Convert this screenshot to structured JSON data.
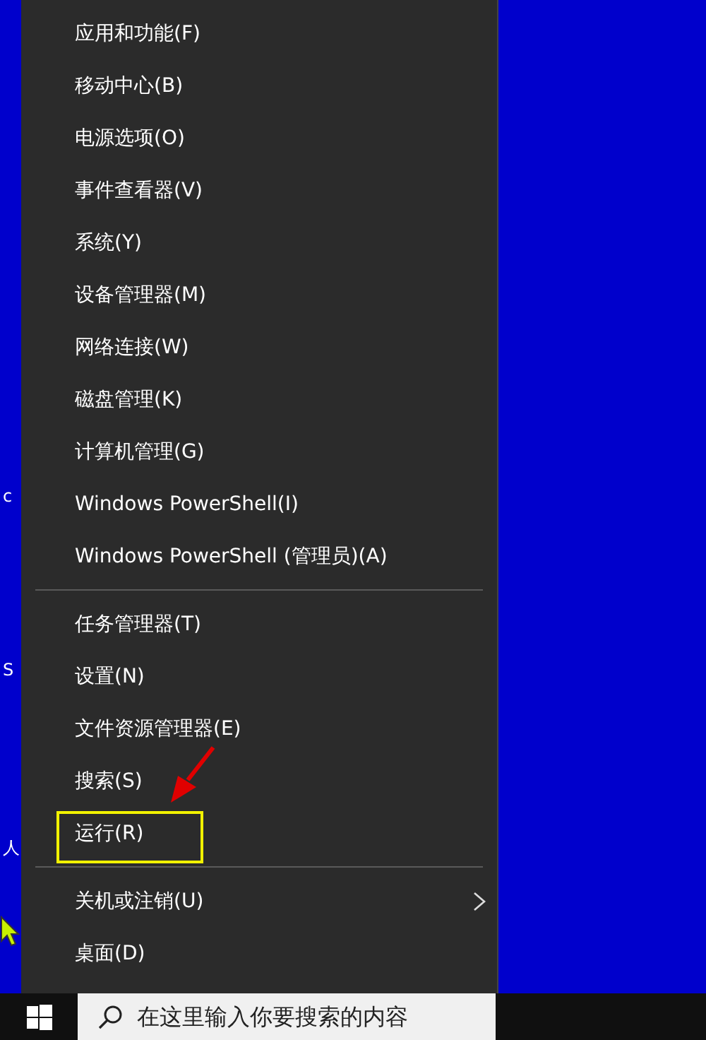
{
  "desktop": {
    "icon_labels": [
      {
        "label": "c"
      },
      {
        "label": "S"
      },
      {
        "label": "人"
      }
    ]
  },
  "menu": {
    "groups": [
      [
        {
          "label": "应用和功能(F)",
          "submenu": false,
          "highlighted": false
        },
        {
          "label": "移动中心(B)",
          "submenu": false,
          "highlighted": false
        },
        {
          "label": "电源选项(O)",
          "submenu": false,
          "highlighted": false
        },
        {
          "label": "事件查看器(V)",
          "submenu": false,
          "highlighted": false
        },
        {
          "label": "系统(Y)",
          "submenu": false,
          "highlighted": false
        },
        {
          "label": "设备管理器(M)",
          "submenu": false,
          "highlighted": false
        },
        {
          "label": "网络连接(W)",
          "submenu": false,
          "highlighted": false
        },
        {
          "label": "磁盘管理(K)",
          "submenu": false,
          "highlighted": false
        },
        {
          "label": "计算机管理(G)",
          "submenu": false,
          "highlighted": false
        },
        {
          "label": "Windows PowerShell(I)",
          "submenu": false,
          "highlighted": false
        },
        {
          "label": "Windows PowerShell (管理员)(A)",
          "submenu": false,
          "highlighted": false
        }
      ],
      [
        {
          "label": "任务管理器(T)",
          "submenu": false,
          "highlighted": false
        },
        {
          "label": "设置(N)",
          "submenu": false,
          "highlighted": false
        },
        {
          "label": "文件资源管理器(E)",
          "submenu": false,
          "highlighted": false
        },
        {
          "label": "搜索(S)",
          "submenu": false,
          "highlighted": false
        },
        {
          "label": "运行(R)",
          "submenu": false,
          "highlighted": true
        }
      ],
      [
        {
          "label": "关机或注销(U)",
          "submenu": true,
          "highlighted": false
        },
        {
          "label": "桌面(D)",
          "submenu": false,
          "highlighted": false
        }
      ]
    ]
  },
  "taskbar": {
    "search": {
      "placeholder": "在这里输入你要搜索的内容"
    }
  }
}
